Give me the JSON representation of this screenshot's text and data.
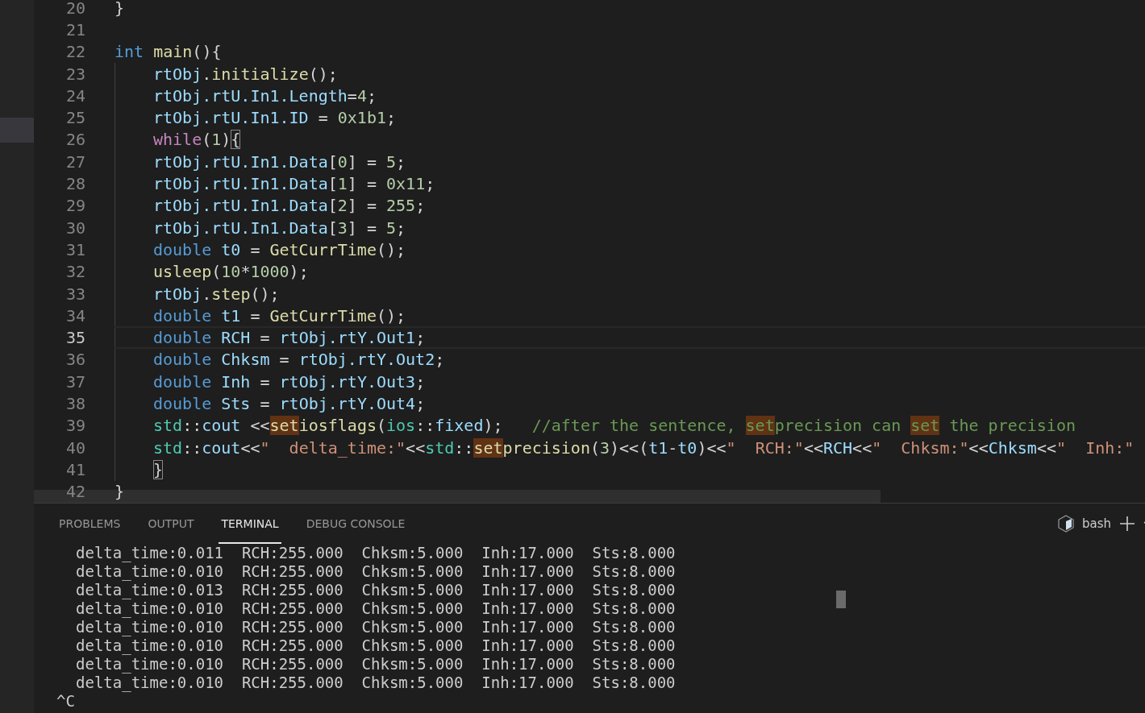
{
  "editor": {
    "lines": [
      {
        "number": "20",
        "indented": false,
        "current": false,
        "tokens": [
          {
            "text": "}",
            "kind": "plain"
          }
        ]
      },
      {
        "number": "21",
        "indented": false,
        "current": false
      },
      {
        "number": "22",
        "indented": false,
        "current": false,
        "tokens": [
          {
            "text": "int",
            "kind": "keyword"
          },
          {
            "text": " main",
            "kind": "func"
          },
          {
            "text": "(){",
            "kind": "plain"
          }
        ]
      },
      {
        "number": "23",
        "indented": true,
        "current": false,
        "tokens": [
          {
            "text": "rtObj",
            "kind": "var"
          },
          {
            "text": ".",
            "kind": "plain"
          },
          {
            "text": "initialize",
            "kind": "func"
          },
          {
            "text": "();",
            "kind": "plain"
          }
        ]
      },
      {
        "number": "24",
        "indented": true,
        "current": false,
        "tokens": [
          {
            "text": "rtObj.rtU.In1.Length",
            "kind": "var"
          },
          {
            "text": "=",
            "kind": "plain"
          },
          {
            "text": "4",
            "kind": "num"
          },
          {
            "text": ";",
            "kind": "plain"
          }
        ]
      },
      {
        "number": "25",
        "indented": true,
        "current": false,
        "tokens": [
          {
            "text": "rtObj.rtU.In1.ID",
            "kind": "var"
          },
          {
            "text": " = ",
            "kind": "plain"
          },
          {
            "text": "0x1b1",
            "kind": "num"
          },
          {
            "text": ";",
            "kind": "plain"
          }
        ]
      },
      {
        "number": "26",
        "indented": true,
        "current": false,
        "tokens": [
          {
            "text": "while",
            "kind": "control"
          },
          {
            "text": "(",
            "kind": "plain"
          },
          {
            "text": "1",
            "kind": "num"
          },
          {
            "text": ")",
            "kind": "plain"
          },
          {
            "text": "{",
            "kind": "bracket_match"
          }
        ]
      },
      {
        "number": "27",
        "indented": true,
        "current": false,
        "tokens": [
          {
            "text": "rtObj.rtU.In1.Data",
            "kind": "var"
          },
          {
            "text": "[",
            "kind": "plain"
          },
          {
            "text": "0",
            "kind": "num"
          },
          {
            "text": "] = ",
            "kind": "plain"
          },
          {
            "text": "5",
            "kind": "num"
          },
          {
            "text": ";",
            "kind": "plain"
          }
        ]
      },
      {
        "number": "28",
        "indented": true,
        "current": false,
        "tokens": [
          {
            "text": "rtObj.rtU.In1.Data",
            "kind": "var"
          },
          {
            "text": "[",
            "kind": "plain"
          },
          {
            "text": "1",
            "kind": "num"
          },
          {
            "text": "] = ",
            "kind": "plain"
          },
          {
            "text": "0x11",
            "kind": "num"
          },
          {
            "text": ";",
            "kind": "plain"
          }
        ]
      },
      {
        "number": "29",
        "indented": true,
        "current": false,
        "tokens": [
          {
            "text": "rtObj.rtU.In1.Data",
            "kind": "var"
          },
          {
            "text": "[",
            "kind": "plain"
          },
          {
            "text": "2",
            "kind": "num"
          },
          {
            "text": "] = ",
            "kind": "plain"
          },
          {
            "text": "255",
            "kind": "num"
          },
          {
            "text": ";",
            "kind": "plain"
          }
        ]
      },
      {
        "number": "30",
        "indented": true,
        "current": false,
        "tokens": [
          {
            "text": "rtObj.rtU.In1.Data",
            "kind": "var"
          },
          {
            "text": "[",
            "kind": "plain"
          },
          {
            "text": "3",
            "kind": "num"
          },
          {
            "text": "] = ",
            "kind": "plain"
          },
          {
            "text": "5",
            "kind": "num"
          },
          {
            "text": ";",
            "kind": "plain"
          }
        ]
      },
      {
        "number": "31",
        "indented": true,
        "current": false,
        "tokens": [
          {
            "text": "double",
            "kind": "keyword"
          },
          {
            "text": " t0",
            "kind": "var"
          },
          {
            "text": " = ",
            "kind": "plain"
          },
          {
            "text": "GetCurrTime",
            "kind": "func"
          },
          {
            "text": "();",
            "kind": "plain"
          }
        ]
      },
      {
        "number": "32",
        "indented": true,
        "current": false,
        "tokens": [
          {
            "text": "usleep",
            "kind": "func"
          },
          {
            "text": "(",
            "kind": "plain"
          },
          {
            "text": "10",
            "kind": "num"
          },
          {
            "text": "*",
            "kind": "plain"
          },
          {
            "text": "1000",
            "kind": "num"
          },
          {
            "text": ");",
            "kind": "plain"
          }
        ]
      },
      {
        "number": "33",
        "indented": true,
        "current": false,
        "tokens": [
          {
            "text": "rtObj",
            "kind": "var"
          },
          {
            "text": ".",
            "kind": "plain"
          },
          {
            "text": "step",
            "kind": "func"
          },
          {
            "text": "();",
            "kind": "plain"
          }
        ]
      },
      {
        "number": "34",
        "indented": true,
        "current": false,
        "tokens": [
          {
            "text": "double",
            "kind": "keyword"
          },
          {
            "text": " t1",
            "kind": "var"
          },
          {
            "text": " = ",
            "kind": "plain"
          },
          {
            "text": "GetCurrTime",
            "kind": "func"
          },
          {
            "text": "();",
            "kind": "plain"
          }
        ]
      },
      {
        "number": "35",
        "indented": true,
        "current": true,
        "tokens": [
          {
            "text": "double",
            "kind": "keyword"
          },
          {
            "text": " RCH",
            "kind": "var"
          },
          {
            "text": " = ",
            "kind": "plain"
          },
          {
            "text": "rtObj.rtY.Out1",
            "kind": "var"
          },
          {
            "text": ";",
            "kind": "plain"
          }
        ]
      },
      {
        "number": "36",
        "indented": true,
        "current": false,
        "tokens": [
          {
            "text": "double",
            "kind": "keyword"
          },
          {
            "text": " Chksm",
            "kind": "var"
          },
          {
            "text": " = ",
            "kind": "plain"
          },
          {
            "text": "rtObj.rtY.Out2",
            "kind": "var"
          },
          {
            "text": ";",
            "kind": "plain"
          }
        ]
      },
      {
        "number": "37",
        "indented": true,
        "current": false,
        "tokens": [
          {
            "text": "double",
            "kind": "keyword"
          },
          {
            "text": " Inh",
            "kind": "var"
          },
          {
            "text": " = ",
            "kind": "plain"
          },
          {
            "text": "rtObj.rtY.Out3",
            "kind": "var"
          },
          {
            "text": ";",
            "kind": "plain"
          }
        ]
      },
      {
        "number": "38",
        "indented": true,
        "current": false,
        "tokens": [
          {
            "text": "double",
            "kind": "keyword"
          },
          {
            "text": " Sts",
            "kind": "var"
          },
          {
            "text": " = ",
            "kind": "plain"
          },
          {
            "text": "rtObj.rtY.Out4",
            "kind": "var"
          },
          {
            "text": ";",
            "kind": "plain"
          }
        ]
      },
      {
        "number": "39",
        "indented": true,
        "current": false,
        "tokens": [
          {
            "text": "std",
            "kind": "ns"
          },
          {
            "text": "::",
            "kind": "plain"
          },
          {
            "text": "cout",
            "kind": "var"
          },
          {
            "text": " <<",
            "kind": "plain"
          },
          {
            "text": "set",
            "kind": "func_match"
          },
          {
            "text": "iosflags",
            "kind": "func"
          },
          {
            "text": "(",
            "kind": "plain"
          },
          {
            "text": "ios",
            "kind": "ns"
          },
          {
            "text": "::",
            "kind": "plain"
          },
          {
            "text": "fixed",
            "kind": "var"
          },
          {
            "text": ");   ",
            "kind": "plain"
          },
          {
            "text": "//after the sentence, ",
            "kind": "comment"
          },
          {
            "text": "set",
            "kind": "comment_match"
          },
          {
            "text": "precision can ",
            "kind": "comment"
          },
          {
            "text": "set",
            "kind": "comment_match"
          },
          {
            "text": " the precision",
            "kind": "comment"
          }
        ]
      },
      {
        "number": "40",
        "indented": true,
        "current": false,
        "tokens": [
          {
            "text": "std",
            "kind": "ns"
          },
          {
            "text": "::",
            "kind": "plain"
          },
          {
            "text": "cout",
            "kind": "var"
          },
          {
            "text": "<<",
            "kind": "plain"
          },
          {
            "text": "\"  delta_time:\"",
            "kind": "str"
          },
          {
            "text": "<<",
            "kind": "plain"
          },
          {
            "text": "std",
            "kind": "ns"
          },
          {
            "text": "::",
            "kind": "plain"
          },
          {
            "text": "set",
            "kind": "func_match"
          },
          {
            "text": "precision",
            "kind": "func"
          },
          {
            "text": "(",
            "kind": "plain"
          },
          {
            "text": "3",
            "kind": "num"
          },
          {
            "text": ")<<(",
            "kind": "plain"
          },
          {
            "text": "t1",
            "kind": "var"
          },
          {
            "text": "-",
            "kind": "plain"
          },
          {
            "text": "t0",
            "kind": "var"
          },
          {
            "text": ")<<",
            "kind": "plain"
          },
          {
            "text": "\"  RCH:\"",
            "kind": "str"
          },
          {
            "text": "<<",
            "kind": "plain"
          },
          {
            "text": "RCH",
            "kind": "var"
          },
          {
            "text": "<<",
            "kind": "plain"
          },
          {
            "text": "\"  Chksm:\"",
            "kind": "str"
          },
          {
            "text": "<<",
            "kind": "plain"
          },
          {
            "text": "Chksm",
            "kind": "var"
          },
          {
            "text": "<<",
            "kind": "plain"
          },
          {
            "text": "\"  Inh:\"",
            "kind": "str"
          }
        ]
      },
      {
        "number": "41",
        "indented": true,
        "current": false,
        "tokens": [
          {
            "text": "}",
            "kind": "bracket_match"
          }
        ]
      },
      {
        "number": "42",
        "indented": false,
        "current": false,
        "tokens": [
          {
            "text": "}",
            "kind": "plain"
          }
        ]
      }
    ]
  },
  "panel": {
    "tabs": [
      {
        "label": "PROBLEMS",
        "selected": false
      },
      {
        "label": "OUTPUT",
        "selected": false
      },
      {
        "label": "TERMINAL",
        "selected": true
      },
      {
        "label": "DEBUG CONSOLE",
        "selected": false
      }
    ],
    "terminal_name": "bash",
    "terminal_lines": [
      "delta_time:0.011  RCH:255.000  Chksm:5.000  Inh:17.000  Sts:8.000",
      "delta_time:0.010  RCH:255.000  Chksm:5.000  Inh:17.000  Sts:8.000",
      "delta_time:0.013  RCH:255.000  Chksm:5.000  Inh:17.000  Sts:8.000",
      "delta_time:0.010  RCH:255.000  Chksm:5.000  Inh:17.000  Sts:8.000",
      "delta_time:0.010  RCH:255.000  Chksm:5.000  Inh:17.000  Sts:8.000",
      "delta_time:0.010  RCH:255.000  Chksm:5.000  Inh:17.000  Sts:8.000",
      "delta_time:0.010  RCH:255.000  Chksm:5.000  Inh:17.000  Sts:8.000",
      "delta_time:0.010  RCH:255.000  Chksm:5.000  Inh:17.000  Sts:8.000"
    ],
    "prompt_line": "^C"
  }
}
